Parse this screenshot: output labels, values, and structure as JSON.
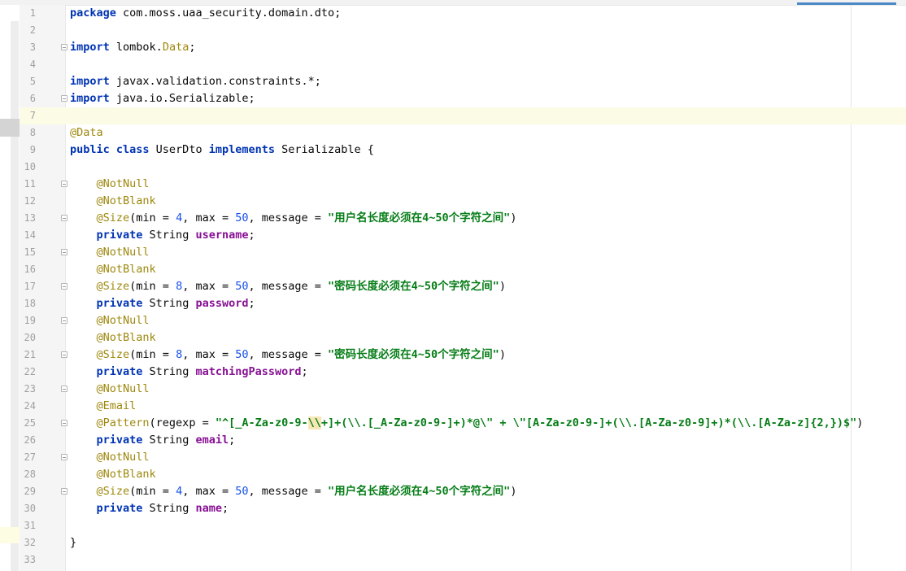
{
  "editor": {
    "lines": [
      {
        "n": "1",
        "fold": false,
        "segs": [
          {
            "c": "kw",
            "t": "package"
          },
          {
            "c": "",
            "t": " com.moss.uaa_security.domain.dto;"
          }
        ]
      },
      {
        "n": "2",
        "fold": false,
        "segs": []
      },
      {
        "n": "3",
        "fold": true,
        "segs": [
          {
            "c": "kw",
            "t": "import"
          },
          {
            "c": "",
            "t": " lombok."
          },
          {
            "c": "ann",
            "t": "Data"
          },
          {
            "c": "",
            "t": ";"
          }
        ]
      },
      {
        "n": "4",
        "fold": false,
        "segs": []
      },
      {
        "n": "5",
        "fold": false,
        "segs": [
          {
            "c": "kw",
            "t": "import"
          },
          {
            "c": "",
            "t": " javax.validation.constraints.*;"
          }
        ]
      },
      {
        "n": "6",
        "fold": true,
        "segs": [
          {
            "c": "kw",
            "t": "import"
          },
          {
            "c": "",
            "t": " java.io.Serializable;"
          }
        ]
      },
      {
        "n": "7",
        "fold": false,
        "current": true,
        "segs": []
      },
      {
        "n": "8",
        "fold": false,
        "segs": [
          {
            "c": "ann",
            "t": "@Data"
          }
        ]
      },
      {
        "n": "9",
        "fold": false,
        "segs": [
          {
            "c": "kw",
            "t": "public class"
          },
          {
            "c": "",
            "t": " UserDto "
          },
          {
            "c": "kw",
            "t": "implements"
          },
          {
            "c": "",
            "t": " Serializable {"
          }
        ]
      },
      {
        "n": "10",
        "fold": false,
        "segs": []
      },
      {
        "n": "11",
        "fold": true,
        "segs": [
          {
            "c": "",
            "t": "    "
          },
          {
            "c": "ann",
            "t": "@NotNull"
          }
        ]
      },
      {
        "n": "12",
        "fold": false,
        "segs": [
          {
            "c": "",
            "t": "    "
          },
          {
            "c": "ann",
            "t": "@NotBlank"
          }
        ]
      },
      {
        "n": "13",
        "fold": true,
        "segs": [
          {
            "c": "",
            "t": "    "
          },
          {
            "c": "ann",
            "t": "@Size"
          },
          {
            "c": "",
            "t": "(min = "
          },
          {
            "c": "num",
            "t": "4"
          },
          {
            "c": "",
            "t": ", max = "
          },
          {
            "c": "num",
            "t": "50"
          },
          {
            "c": "",
            "t": ", message = "
          },
          {
            "c": "str",
            "t": "\"用户名长度必须在4~50个字符之间\""
          },
          {
            "c": "",
            "t": ")"
          }
        ]
      },
      {
        "n": "14",
        "fold": false,
        "segs": [
          {
            "c": "",
            "t": "    "
          },
          {
            "c": "kw",
            "t": "private"
          },
          {
            "c": "",
            "t": " String "
          },
          {
            "c": "fld",
            "t": "username"
          },
          {
            "c": "",
            "t": ";"
          }
        ]
      },
      {
        "n": "15",
        "fold": true,
        "segs": [
          {
            "c": "",
            "t": "    "
          },
          {
            "c": "ann",
            "t": "@NotNull"
          }
        ]
      },
      {
        "n": "16",
        "fold": false,
        "segs": [
          {
            "c": "",
            "t": "    "
          },
          {
            "c": "ann",
            "t": "@NotBlank"
          }
        ]
      },
      {
        "n": "17",
        "fold": true,
        "segs": [
          {
            "c": "",
            "t": "    "
          },
          {
            "c": "ann",
            "t": "@Size"
          },
          {
            "c": "",
            "t": "(min = "
          },
          {
            "c": "num",
            "t": "8"
          },
          {
            "c": "",
            "t": ", max = "
          },
          {
            "c": "num",
            "t": "50"
          },
          {
            "c": "",
            "t": ", message = "
          },
          {
            "c": "str",
            "t": "\"密码长度必须在4~50个字符之间\""
          },
          {
            "c": "",
            "t": ")"
          }
        ]
      },
      {
        "n": "18",
        "fold": false,
        "segs": [
          {
            "c": "",
            "t": "    "
          },
          {
            "c": "kw",
            "t": "private"
          },
          {
            "c": "",
            "t": " String "
          },
          {
            "c": "fld",
            "t": "password"
          },
          {
            "c": "",
            "t": ";"
          }
        ]
      },
      {
        "n": "19",
        "fold": true,
        "segs": [
          {
            "c": "",
            "t": "    "
          },
          {
            "c": "ann",
            "t": "@NotNull"
          }
        ]
      },
      {
        "n": "20",
        "fold": false,
        "segs": [
          {
            "c": "",
            "t": "    "
          },
          {
            "c": "ann",
            "t": "@NotBlank"
          }
        ]
      },
      {
        "n": "21",
        "fold": true,
        "segs": [
          {
            "c": "",
            "t": "    "
          },
          {
            "c": "ann",
            "t": "@Size"
          },
          {
            "c": "",
            "t": "(min = "
          },
          {
            "c": "num",
            "t": "8"
          },
          {
            "c": "",
            "t": ", max = "
          },
          {
            "c": "num",
            "t": "50"
          },
          {
            "c": "",
            "t": ", message = "
          },
          {
            "c": "str",
            "t": "\"密码长度必须在4~50个字符之间\""
          },
          {
            "c": "",
            "t": ")"
          }
        ]
      },
      {
        "n": "22",
        "fold": false,
        "segs": [
          {
            "c": "",
            "t": "    "
          },
          {
            "c": "kw",
            "t": "private"
          },
          {
            "c": "",
            "t": " String "
          },
          {
            "c": "fld",
            "t": "matchingPassword"
          },
          {
            "c": "",
            "t": ";"
          }
        ]
      },
      {
        "n": "23",
        "fold": true,
        "segs": [
          {
            "c": "",
            "t": "    "
          },
          {
            "c": "ann",
            "t": "@NotNull"
          }
        ]
      },
      {
        "n": "24",
        "fold": false,
        "segs": [
          {
            "c": "",
            "t": "    "
          },
          {
            "c": "ann",
            "t": "@Email"
          }
        ]
      },
      {
        "n": "25",
        "fold": true,
        "segs": [
          {
            "c": "",
            "t": "    "
          },
          {
            "c": "ann",
            "t": "@Pattern"
          },
          {
            "c": "",
            "t": "(regexp = "
          },
          {
            "c": "str",
            "t": "\"^[_A-Za-z0-9-"
          },
          {
            "c": "str hl",
            "t": "\\\\"
          },
          {
            "c": "str",
            "t": "+]+(\\\\.[_A-Za-z0-9-]+)*@\\\" + \\\"[A-Za-z0-9-]+(\\\\.[A-Za-z0-9]+)*(\\\\.[A-Za-z]{2,})$\""
          },
          {
            "c": "",
            "t": ")"
          }
        ]
      },
      {
        "n": "26",
        "fold": false,
        "segs": [
          {
            "c": "",
            "t": "    "
          },
          {
            "c": "kw",
            "t": "private"
          },
          {
            "c": "",
            "t": " String "
          },
          {
            "c": "fld",
            "t": "email"
          },
          {
            "c": "",
            "t": ";"
          }
        ]
      },
      {
        "n": "27",
        "fold": true,
        "segs": [
          {
            "c": "",
            "t": "    "
          },
          {
            "c": "ann",
            "t": "@NotNull"
          }
        ]
      },
      {
        "n": "28",
        "fold": false,
        "segs": [
          {
            "c": "",
            "t": "    "
          },
          {
            "c": "ann",
            "t": "@NotBlank"
          }
        ]
      },
      {
        "n": "29",
        "fold": true,
        "segs": [
          {
            "c": "",
            "t": "    "
          },
          {
            "c": "ann",
            "t": "@Size"
          },
          {
            "c": "",
            "t": "(min = "
          },
          {
            "c": "num",
            "t": "4"
          },
          {
            "c": "",
            "t": ", max = "
          },
          {
            "c": "num",
            "t": "50"
          },
          {
            "c": "",
            "t": ", message = "
          },
          {
            "c": "str",
            "t": "\"用户名长度必须在4~50个字符之间\""
          },
          {
            "c": "",
            "t": ")"
          }
        ]
      },
      {
        "n": "30",
        "fold": false,
        "segs": [
          {
            "c": "",
            "t": "    "
          },
          {
            "c": "kw",
            "t": "private"
          },
          {
            "c": "",
            "t": " String "
          },
          {
            "c": "fld",
            "t": "name"
          },
          {
            "c": "",
            "t": ";"
          }
        ]
      },
      {
        "n": "31",
        "fold": false,
        "segs": []
      },
      {
        "n": "32",
        "fold": false,
        "segs": [
          {
            "c": "",
            "t": "}"
          }
        ]
      },
      {
        "n": "33",
        "fold": false,
        "segs": []
      }
    ]
  }
}
